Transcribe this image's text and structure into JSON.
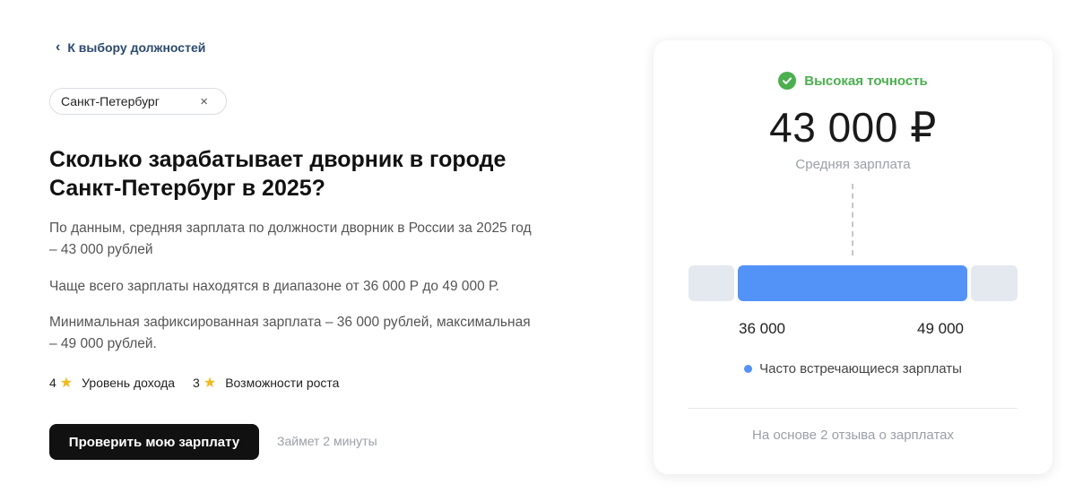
{
  "nav": {
    "back_label": "К выбору должностей"
  },
  "filter": {
    "city": "Санкт-Петербург"
  },
  "content": {
    "headline_line1": "Сколько зарабатывает дворник в городе",
    "headline_line2": "Санкт-Петербург в 2025?",
    "p1_line1": "По данным, средняя зарплата по должности дворник в России за 2025 год",
    "p1_line2": "– 43 000 рублей",
    "p2": "Чаще всего зарплаты находятся в диапазоне от 36 000 Р до 49 000 Р.",
    "p3_line1": "Минимальная зафиксированная зарплата – 36 000 рублей, максимальная",
    "p3_line2": "– 49 000 рублей."
  },
  "ratings": [
    {
      "score": "4",
      "label": "Уровень дохода"
    },
    {
      "score": "3",
      "label": "Возможности роста"
    }
  ],
  "cta": {
    "button_label": "Проверить мою зарплату",
    "time_note": "Займет 2 минуты"
  },
  "card": {
    "accuracy_label": "Высокая точность",
    "amount": "43 000 ₽",
    "amount_label": "Средняя зарплата",
    "range_min": "36 000",
    "range_max": "49 000",
    "legend_label": "Часто встречающиеся зарплаты",
    "basis": "На основе 2 отзыва о зарплатах"
  },
  "colors": {
    "accent_blue": "#5393f7",
    "success_green": "#4caf50",
    "star": "#f2b91c"
  }
}
